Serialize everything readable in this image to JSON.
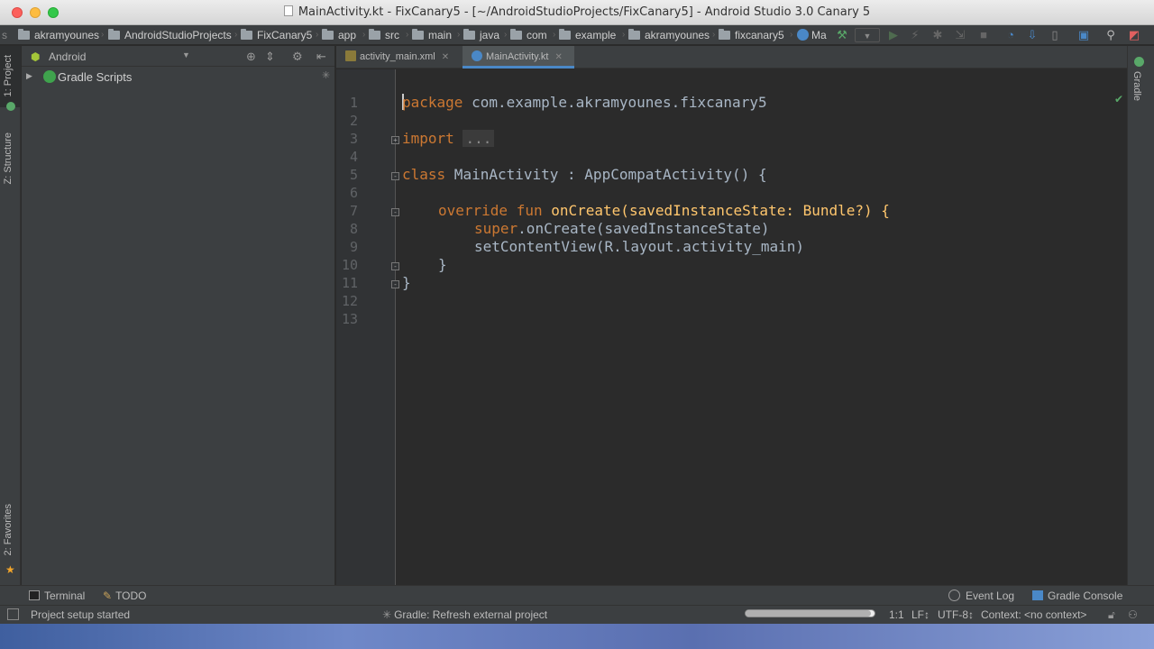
{
  "window": {
    "title": "MainActivity.kt - FixCanary5 - [~/AndroidStudioProjects/FixCanary5] - Android Studio 3.0 Canary 5"
  },
  "breadcrumbs": [
    "akramyounes",
    "AndroidStudioProjects",
    "FixCanary5",
    "app",
    "src",
    "main",
    "java",
    "com",
    "example",
    "akramyounes",
    "fixcanary5",
    "Ma"
  ],
  "left_tool_tabs": {
    "project": "1: Project",
    "structure": "Z: Structure",
    "favorites": "2: Favorites"
  },
  "right_tool_tabs": {
    "gradle": "Gradle"
  },
  "project_panel": {
    "view_mode": "Android",
    "tree": [
      {
        "label": "Gradle Scripts",
        "expanded": false
      }
    ]
  },
  "editor_tabs": [
    {
      "label": "activity_main.xml",
      "active": false
    },
    {
      "label": "MainActivity.kt",
      "active": true
    }
  ],
  "code": {
    "line_numbers": [
      "1",
      "2",
      "3",
      "4",
      "5",
      "6",
      "7",
      "8",
      "9",
      "10",
      "11",
      "12",
      "13"
    ],
    "l1_kw": "package",
    "l1_rest": " com.example.akramyounes.fixcanary5",
    "l3_kw": "import",
    "l3_dots": "...",
    "l6_kw": "class",
    "l6_rest": " MainActivity : AppCompatActivity() {",
    "l8_kw1": "override",
    "l8_kw2": "fun",
    "l8_rest": " onCreate(savedInstanceState: Bundle?) {",
    "l9_kw": "super",
    "l9_rest": ".onCreate(savedInstanceState)",
    "l10": "setContentView(R.layout.activity_main)",
    "l11": "}",
    "l12": "}"
  },
  "bottom_tools": {
    "terminal": "Terminal",
    "todo": "TODO",
    "event_log": "Event Log",
    "gradle_console": "Gradle Console"
  },
  "status": {
    "message": "Project setup started",
    "task": "Gradle: Refresh external project",
    "progress": 0.97,
    "position": "1:1",
    "line_sep": "LF↕",
    "encoding": "UTF-8↕",
    "context": "Context: <no context>"
  }
}
